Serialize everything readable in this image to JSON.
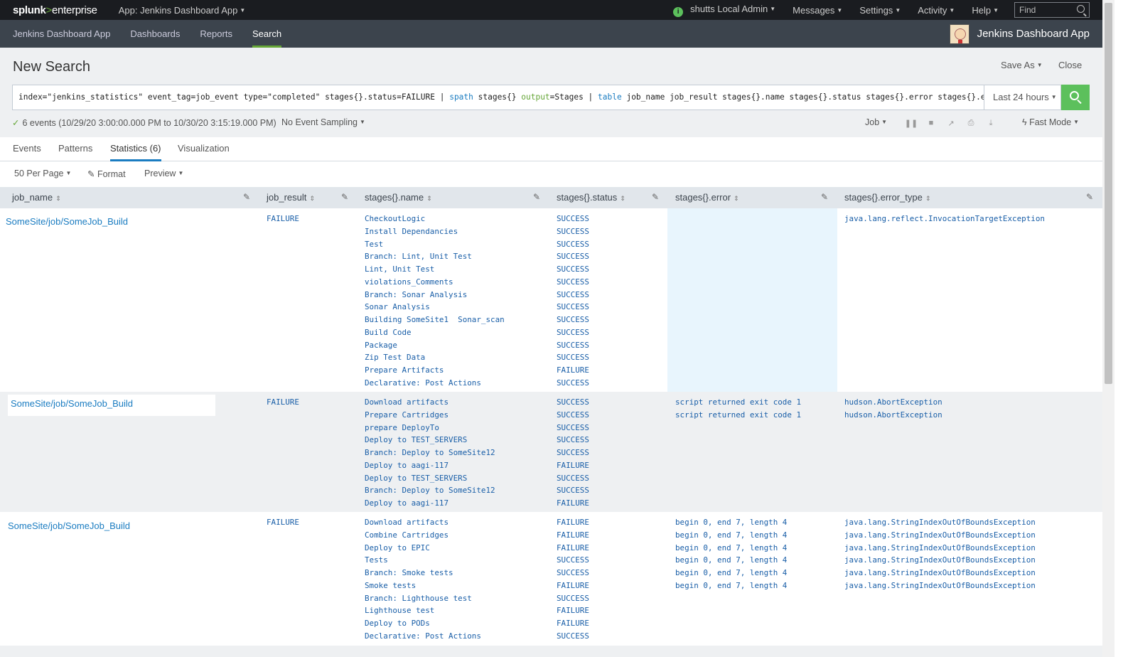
{
  "topbar": {
    "logo_main": "splunk",
    "logo_gt": ">",
    "logo_sub": "enterprise",
    "app_menu": "App: Jenkins Dashboard App",
    "user": "shutts Local Admin",
    "messages": "Messages",
    "settings": "Settings",
    "activity": "Activity",
    "help": "Help",
    "find_placeholder": "Find"
  },
  "appbar": {
    "nav": [
      "Jenkins Dashboard App",
      "Dashboards",
      "Reports",
      "Search"
    ],
    "active": "Search",
    "brand": "Jenkins Dashboard App"
  },
  "search": {
    "title": "New Search",
    "save_as": "Save As",
    "close": "Close",
    "query_parts": [
      {
        "text": "index=\"jenkins_statistics\" event_tag=job_event type=\"completed\" stages{}.status=FAILURE | ",
        "style": "plain"
      },
      {
        "text": "spath",
        "style": "kw"
      },
      {
        "text": " stages{} ",
        "style": "plain"
      },
      {
        "text": "output",
        "style": "arg"
      },
      {
        "text": "=Stages | ",
        "style": "plain"
      },
      {
        "text": "table",
        "style": "kw"
      },
      {
        "text": " job_name job_result stages{}.name stages{}.status stages{}.error stages{}.error_type",
        "style": "plain"
      }
    ],
    "time_range": "Last 24 hours",
    "events_info": "6 events (10/29/20 3:00:00.000 PM to 10/30/20 3:15:19.000 PM)",
    "sampling": "No Event Sampling",
    "job": "Job",
    "mode": "Fast Mode"
  },
  "tabs": [
    "Events",
    "Patterns",
    "Statistics (6)",
    "Visualization"
  ],
  "active_tab": "Statistics (6)",
  "options": {
    "per_page": "50 Per Page",
    "format": "Format",
    "preview": "Preview"
  },
  "columns": [
    "job_name",
    "job_result",
    "stages{}.name",
    "stages{}.status",
    "stages{}.error",
    "stages{}.error_type"
  ],
  "rows": [
    {
      "job_name": "SomeSite/job/SomeJob_Build",
      "job_result": "FAILURE",
      "names": [
        "CheckoutLogic",
        "Install Dependancies",
        "Test",
        "Branch: Lint, Unit Test",
        "Lint, Unit Test",
        "violations_Comments",
        "Branch: Sonar Analysis",
        "Sonar Analysis",
        "Building SomeSite1  Sonar_scan",
        "Build Code",
        "Package",
        "Zip Test Data",
        "Prepare Artifacts",
        "Declarative: Post Actions"
      ],
      "statuses": [
        "SUCCESS",
        "SUCCESS",
        "SUCCESS",
        "SUCCESS",
        "SUCCESS",
        "SUCCESS",
        "SUCCESS",
        "SUCCESS",
        "SUCCESS",
        "SUCCESS",
        "SUCCESS",
        "SUCCESS",
        "FAILURE",
        "SUCCESS"
      ],
      "errors": [],
      "error_types": [
        "java.lang.reflect.InvocationTargetException"
      ]
    },
    {
      "job_name": "SomeSite/job/SomeJob_Build",
      "job_result": "FAILURE",
      "names": [
        "Download artifacts",
        "Prepare Cartridges",
        "prepare DeployTo",
        "Deploy to TEST_SERVERS",
        "Branch: Deploy to SomeSite12",
        "Deploy to aagi-117",
        "Deploy to TEST_SERVERS",
        "Branch: Deploy to SomeSite12",
        "Deploy to aagi-117"
      ],
      "statuses": [
        "SUCCESS",
        "SUCCESS",
        "SUCCESS",
        "SUCCESS",
        "SUCCESS",
        "FAILURE",
        "SUCCESS",
        "SUCCESS",
        "FAILURE"
      ],
      "errors": [
        "script returned exit code 1",
        "script returned exit code 1"
      ],
      "error_types": [
        "hudson.AbortException",
        "hudson.AbortException"
      ]
    },
    {
      "job_name": "SomeSite/job/SomeJob_Build",
      "job_result": "FAILURE",
      "names": [
        "Download artifacts",
        "Combine Cartridges",
        "Deploy to EPIC",
        "Tests",
        "Branch: Smoke tests",
        "Smoke tests",
        "Branch: Lighthouse test",
        "Lighthouse test",
        "Deploy to PODs",
        "Declarative: Post Actions"
      ],
      "statuses": [
        "FAILURE",
        "FAILURE",
        "FAILURE",
        "SUCCESS",
        "SUCCESS",
        "FAILURE",
        "SUCCESS",
        "FAILURE",
        "FAILURE",
        "SUCCESS"
      ],
      "errors": [
        "begin 0, end 7, length 4",
        "begin 0, end 7, length 4",
        "begin 0, end 7, length 4",
        "begin 0, end 7, length 4",
        "begin 0, end 7, length 4",
        "begin 0, end 7, length 4"
      ],
      "error_types": [
        "java.lang.StringIndexOutOfBoundsException",
        "java.lang.StringIndexOutOfBoundsException",
        "java.lang.StringIndexOutOfBoundsException",
        "java.lang.StringIndexOutOfBoundsException",
        "java.lang.StringIndexOutOfBoundsException",
        "java.lang.StringIndexOutOfBoundsException"
      ]
    }
  ],
  "colors": {
    "accent_green": "#65a637",
    "link_blue": "#1a7cc1",
    "cell_blue": "#1a5fa8",
    "topbar": "#1a1c20",
    "appbar": "#3c444d",
    "highlight_cell": "#e8f5fd"
  }
}
